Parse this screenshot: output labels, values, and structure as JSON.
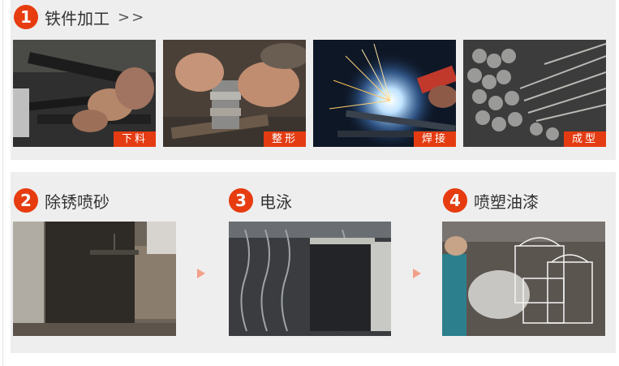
{
  "section1": {
    "number": "1",
    "title": "铁件加工",
    "more": ">>",
    "photos": [
      {
        "label": "下料",
        "icon": "cutting-photo"
      },
      {
        "label": "整形",
        "icon": "shaping-photo"
      },
      {
        "label": "焊接",
        "icon": "welding-photo"
      },
      {
        "label": "成型",
        "icon": "forming-photo"
      }
    ]
  },
  "section2": {
    "steps": [
      {
        "number": "2",
        "title": "除锈喷砂",
        "icon": "sandblasting-photo"
      },
      {
        "number": "3",
        "title": "电泳",
        "icon": "electrophoresis-photo"
      },
      {
        "number": "4",
        "title": "喷塑油漆",
        "icon": "spray-painting-photo"
      }
    ]
  },
  "colors": {
    "accent": "#e63c0f",
    "panel": "#eeeeee",
    "arrow": "#f2a089"
  }
}
